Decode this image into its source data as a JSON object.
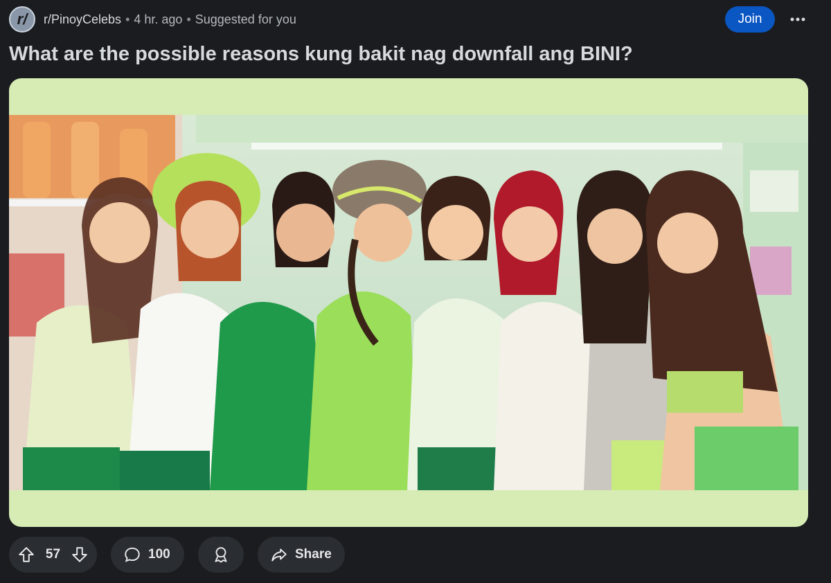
{
  "post": {
    "subreddit_avatar": "r/",
    "subreddit": "r/PinoyCelebs",
    "time": "4 hr. ago",
    "suggested": "Suggested for you",
    "join_label": "Join",
    "title": "What are the possible reasons kung bakit nag downfall ang BINI?"
  },
  "actions": {
    "vote_count": "57",
    "comment_count": "100",
    "share_label": "Share"
  },
  "icons": {
    "upvote": "arrow-up-icon",
    "downvote": "arrow-down-icon",
    "comment": "speech-bubble-icon",
    "award": "award-icon",
    "share": "share-arrow-icon",
    "more": "ellipsis-icon"
  },
  "colors": {
    "background": "#1a1c1f",
    "join_button": "#0a56c2",
    "pill": "#2a2d31",
    "media_frame": "#d6ecb4"
  }
}
